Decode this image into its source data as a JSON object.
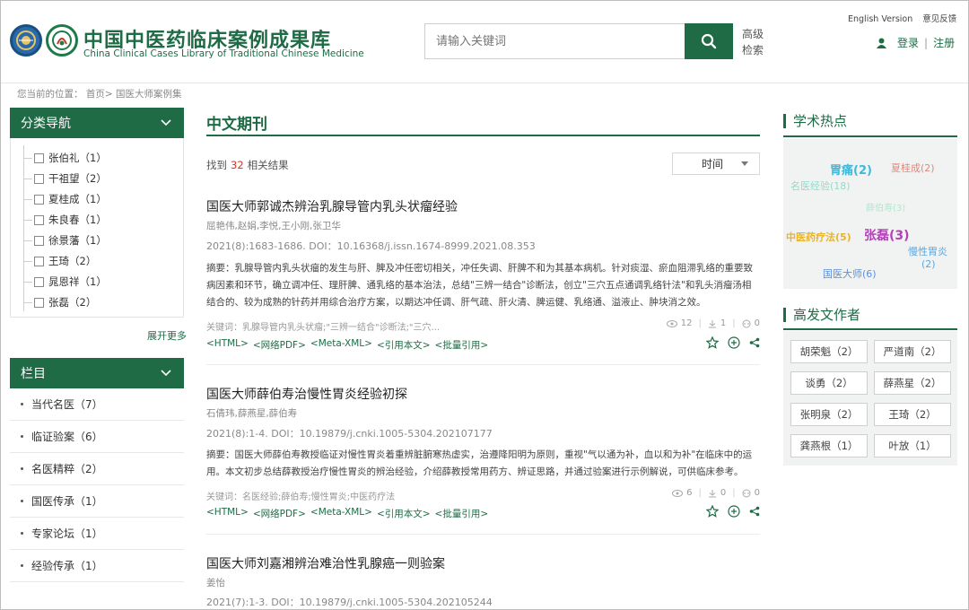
{
  "header": {
    "logo_cn": "中国中医药临床案例成果库",
    "logo_en": "China Clinical Cases Library of Traditional Chinese Medicine",
    "search_placeholder": "请输入关键词",
    "advanced_search": "高级检索",
    "english_version": "English Version",
    "feedback": "意见反馈",
    "login": "登录",
    "register": "注册",
    "separator": "|"
  },
  "breadcrumb": "您当前的位置： 首页> 国医大师案例集",
  "category_nav": {
    "title": "分类导航",
    "items": [
      {
        "label": "张伯礼（1）"
      },
      {
        "label": "干祖望（2）"
      },
      {
        "label": "夏桂成（1）"
      },
      {
        "label": "朱良春（1）"
      },
      {
        "label": "徐景藩（1）"
      },
      {
        "label": "王琦（2）"
      },
      {
        "label": "晁恩祥（1）"
      },
      {
        "label": "张磊（2）"
      }
    ],
    "expand_more": "展开更多"
  },
  "columns": {
    "title": "栏目",
    "items": [
      {
        "label": "当代名医（7）"
      },
      {
        "label": "临证验案（6）"
      },
      {
        "label": "名医精粹（2）"
      },
      {
        "label": "国医传承（1）"
      },
      {
        "label": "专家论坛（1）"
      },
      {
        "label": "经验传承（1）"
      }
    ]
  },
  "main": {
    "section_title": "中文期刊",
    "found_prefix": "找到",
    "found_count": "32",
    "found_suffix": "相关结果",
    "sort_label": "时间",
    "articles": [
      {
        "title": "国医大师郭诚杰辨治乳腺导管内乳头状瘤经验",
        "authors": "屈艳伟,赵娟,李悦,王小刚,张卫华",
        "source": "2021(8):1683-1686. DOI：10.16368/j.issn.1674-8999.2021.08.353",
        "abstract": "摘要：乳腺导管内乳头状瘤的发生与肝、脾及冲任密切相关，冲任失调、肝脾不和为其基本病机。针对痰湿、瘀血阻滞乳络的重要致病因素和环节，确立调冲任、理肝脾、通乳络的基本治法，总结\"三辨一结合\"诊断法，创立\"三穴五点通调乳络针法\"和乳头消瘤汤相结合的、较为成熟的针药并用综合治疗方案，以期达冲任调、肝气疏、肝火清、脾运健、乳络通、溢液止、肿块消之效。",
        "keywords": "关键词：乳腺导管内乳头状瘤;\"三辨一结合\"诊断法;\"三穴...",
        "views": "12",
        "downloads": "1",
        "cites": "0",
        "links": [
          "<HTML>",
          "<网络PDF>",
          "<Meta-XML>",
          "<引用本文>",
          "<批量引用>"
        ]
      },
      {
        "title": "国医大师薛伯寿治慢性胃炎经验初探",
        "authors": "石倩玮,薛燕星,薛伯寿",
        "source": "2021(8):1-4. DOI：10.19879/j.cnki.1005-5304.202107177",
        "abstract": "摘要：国医大师薛伯寿教授临证对慢性胃炎着重辨脏腑寒热虚实，治遵降阳明为原则，重视\"气以通为补，血以和为补\"在临床中的运用。本文初步总结薛教授治疗慢性胃炎的辨治经验，介绍薛教授常用药方、辨证思路，并通过验案进行示例解说，可供临床参考。",
        "keywords": "关键词：名医经验;薛伯寿;慢性胃炎;中医药疗法",
        "views": "6",
        "downloads": "0",
        "cites": "0",
        "links": [
          "<HTML>",
          "<网络PDF>",
          "<Meta-XML>",
          "<引用本文>",
          "<批量引用>"
        ]
      },
      {
        "title": "国医大师刘嘉湘辨治难治性乳腺癌一则验案",
        "authors": "姜怡",
        "source": "2021(7):1-3. DOI：10.19879/j.cnki.1005-5304.202105244"
      }
    ]
  },
  "hot_topics": {
    "title": "学术热点",
    "words": [
      {
        "text": "胃痛(2)",
        "color": "#41b8d8"
      },
      {
        "text": "夏桂成(2)",
        "color": "#e4867a"
      },
      {
        "text": "名医经验(18)",
        "color": "#8fdccb"
      },
      {
        "text": "薛伯寿(3)",
        "color": "#b3e6cf"
      },
      {
        "text": "中医药疗法(5)",
        "color": "#e8b52a"
      },
      {
        "text": "张磊(3)",
        "color": "#b43fb9"
      },
      {
        "text": "慢性胃炎",
        "color": "#58a8e0"
      },
      {
        "text": "(2)",
        "color": "#58a8e0"
      },
      {
        "text": "国医大师(6)",
        "color": "#5f8fd6"
      }
    ]
  },
  "top_authors": {
    "title": "高发文作者",
    "items": [
      {
        "label": "胡荣魁（2）"
      },
      {
        "label": "严道南（2）"
      },
      {
        "label": "谈勇（2）"
      },
      {
        "label": "薛燕星（2）"
      },
      {
        "label": "张明泉（2）"
      },
      {
        "label": "王琦（2）"
      },
      {
        "label": "龚燕根（1）"
      },
      {
        "label": "叶放（1）"
      }
    ]
  },
  "colors": {
    "brand_green": "#1e6b46",
    "highlight_red": "#d9342b"
  }
}
